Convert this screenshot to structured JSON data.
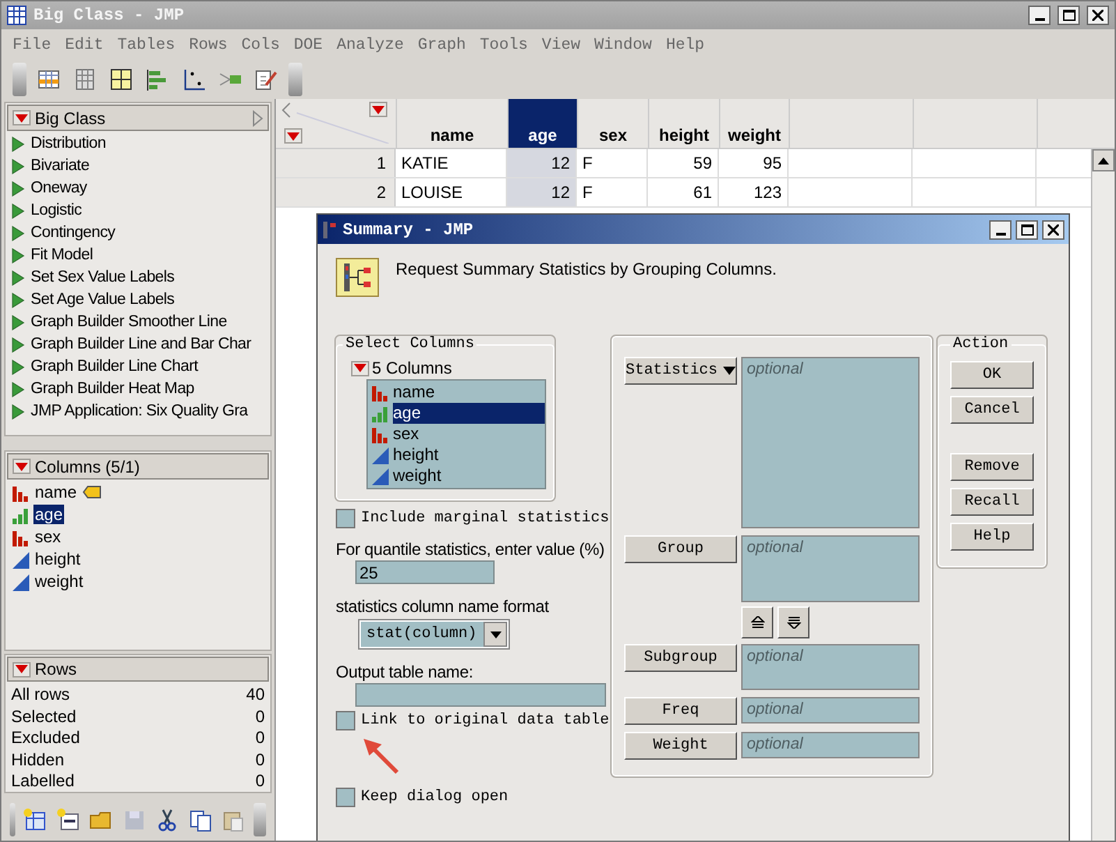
{
  "window": {
    "title": "Big Class - JMP"
  },
  "menu": [
    "File",
    "Edit",
    "Tables",
    "Rows",
    "Cols",
    "DOE",
    "Analyze",
    "Graph",
    "Tools",
    "View",
    "Window",
    "Help"
  ],
  "table_panel": {
    "title": "Big Class",
    "scripts": [
      "Distribution",
      "Bivariate",
      "Oneway",
      "Logistic",
      "Contingency",
      "Fit Model",
      "Set Sex Value Labels",
      "Set Age Value Labels",
      "Graph Builder Smoother Line",
      "Graph Builder Line and Bar Char",
      "Graph Builder Line Chart",
      "Graph Builder Heat Map",
      "JMP Application: Six Quality Gra"
    ]
  },
  "columns_panel": {
    "title": "Columns (5/1)",
    "columns": [
      {
        "name": "name",
        "kind": "nominal",
        "label_role": true,
        "selected": false
      },
      {
        "name": "age",
        "kind": "ordinal",
        "label_role": false,
        "selected": true
      },
      {
        "name": "sex",
        "kind": "nominal",
        "label_role": false,
        "selected": false
      },
      {
        "name": "height",
        "kind": "continuous",
        "label_role": false,
        "selected": false
      },
      {
        "name": "weight",
        "kind": "continuous",
        "label_role": false,
        "selected": false
      }
    ]
  },
  "rows_panel": {
    "title": "Rows",
    "rows": [
      {
        "label": "All rows",
        "count": "40"
      },
      {
        "label": "Selected",
        "count": "0"
      },
      {
        "label": "Excluded",
        "count": "0"
      },
      {
        "label": "Hidden",
        "count": "0"
      },
      {
        "label": "Labelled",
        "count": "0"
      }
    ]
  },
  "grid": {
    "columns": [
      {
        "name": "name",
        "kind": "text",
        "selected": false
      },
      {
        "name": "age",
        "kind": "number",
        "selected": true
      },
      {
        "name": "sex",
        "kind": "text",
        "selected": false
      },
      {
        "name": "height",
        "kind": "number",
        "selected": false
      },
      {
        "name": "weight",
        "kind": "number",
        "selected": false
      }
    ],
    "rows": [
      {
        "number": "1",
        "cells": [
          "KATIE",
          "12",
          "F",
          "59",
          "95"
        ]
      },
      {
        "number": "2",
        "cells": [
          "LOUISE",
          "12",
          "F",
          "61",
          "123"
        ]
      }
    ]
  },
  "dialog": {
    "title": "Summary - JMP",
    "instruction": "Request Summary Statistics by Grouping Columns.",
    "select_columns": {
      "legend": "Select Columns",
      "count": "5 Columns",
      "columns": [
        {
          "name": "name",
          "kind": "nominal",
          "selected": false
        },
        {
          "name": "age",
          "kind": "ordinal",
          "selected": true
        },
        {
          "name": "sex",
          "kind": "nominal",
          "selected": false
        },
        {
          "name": "height",
          "kind": "continuous",
          "selected": false
        },
        {
          "name": "weight",
          "kind": "continuous",
          "selected": false
        }
      ]
    },
    "include_marginal": {
      "label": "Include marginal statistics",
      "checked": false
    },
    "quantile": {
      "label": "For quantile statistics, enter value (%)",
      "value": "25"
    },
    "name_format": {
      "label": "statistics column name format",
      "value": "stat(column)"
    },
    "output_name": {
      "label": "Output table name:"
    },
    "link": {
      "label": "Link to original data table",
      "checked": false
    },
    "keep_open": {
      "label": "Keep dialog open",
      "checked": false
    },
    "roles": [
      {
        "label": "Statistics",
        "kind": "large",
        "menu": true,
        "placeholder": "optional"
      },
      {
        "label": "Group",
        "kind": "medium",
        "menu": false,
        "placeholder": "optional",
        "reorder": true
      },
      {
        "label": "Subgroup",
        "kind": "small",
        "menu": false,
        "placeholder": "optional"
      },
      {
        "label": "Freq",
        "kind": "single",
        "menu": false,
        "placeholder": "optional"
      },
      {
        "label": "Weight",
        "kind": "single",
        "menu": false,
        "placeholder": "optional"
      }
    ],
    "action": {
      "legend": "Action",
      "groups": [
        [
          "OK",
          "Cancel"
        ],
        [
          "Remove",
          "Recall",
          "Help"
        ]
      ]
    }
  }
}
